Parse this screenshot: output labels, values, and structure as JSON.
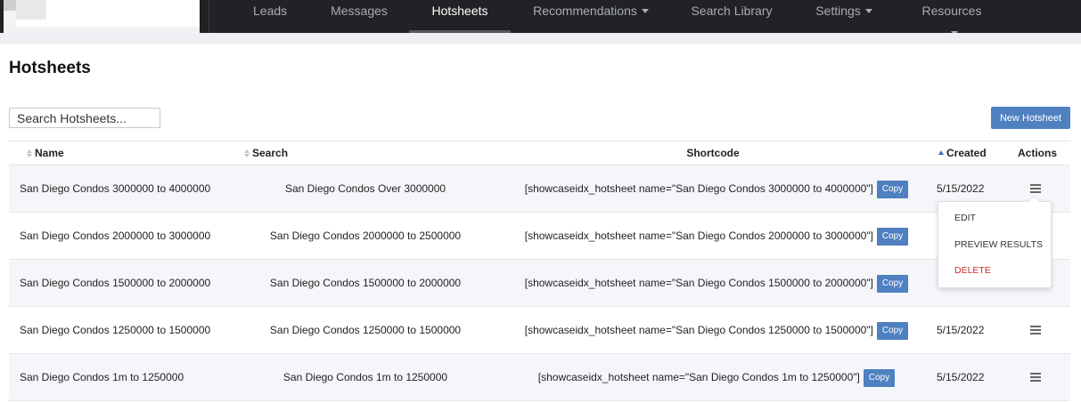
{
  "nav": {
    "items": [
      {
        "label": "Leads",
        "dropdown": false,
        "active": false
      },
      {
        "label": "Messages",
        "dropdown": false,
        "active": false
      },
      {
        "label": "Hotsheets",
        "dropdown": false,
        "active": true
      },
      {
        "label": "Recommendations",
        "dropdown": true,
        "active": false
      },
      {
        "label": "Search Library",
        "dropdown": false,
        "active": false
      },
      {
        "label": "Settings",
        "dropdown": true,
        "active": false
      },
      {
        "label": "Resources",
        "dropdown": true,
        "active": false
      }
    ]
  },
  "page": {
    "title": "Hotsheets"
  },
  "search": {
    "placeholder": "Search Hotsheets..."
  },
  "toolbar": {
    "new_label": "New Hotsheet"
  },
  "table": {
    "headers": {
      "name": "Name",
      "search": "Search",
      "shortcode": "Shortcode",
      "created": "Created",
      "actions": "Actions"
    },
    "copy_label": "Copy",
    "rows": [
      {
        "name": "San Diego Condos 3000000 to 4000000",
        "search": "San Diego Condos Over 3000000",
        "shortcode": "[showcaseidx_hotsheet name=\"San Diego Condos 3000000 to 4000000\"]",
        "created": "5/15/2022"
      },
      {
        "name": "San Diego Condos 2000000 to 3000000",
        "search": "San Diego Condos 2000000 to 2500000",
        "shortcode": "[showcaseidx_hotsheet name=\"San Diego Condos 2000000 to 3000000\"]",
        "created": ""
      },
      {
        "name": "San Diego Condos 1500000 to 2000000",
        "search": "San Diego Condos 1500000 to 2000000",
        "shortcode": "[showcaseidx_hotsheet name=\"San Diego Condos 1500000 to 2000000\"]",
        "created": ""
      },
      {
        "name": "San Diego Condos 1250000 to 1500000",
        "search": "San Diego Condos 1250000 to 1500000",
        "shortcode": "[showcaseidx_hotsheet name=\"San Diego Condos 1250000 to 1500000\"]",
        "created": "5/15/2022"
      },
      {
        "name": "San Diego Condos 1m to 1250000",
        "search": "San Diego Condos 1m to 1250000",
        "shortcode": "[showcaseidx_hotsheet name=\"San Diego Condos 1m to 1250000\"]",
        "created": "5/15/2022"
      }
    ]
  },
  "actions_menu": {
    "edit": "EDIT",
    "preview": "PREVIEW RESULTS",
    "delete": "DELETE"
  },
  "colors": {
    "nav_bg": "#212225",
    "accent": "#4f80c0",
    "danger": "#c9302c",
    "row_shade": "#f4f6fa"
  }
}
